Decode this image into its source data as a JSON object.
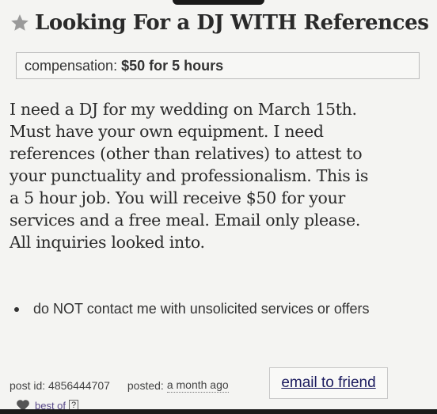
{
  "post": {
    "title": "Looking For a DJ WITH References",
    "compensation_label": "compensation:",
    "compensation_value": "$50 for 5 hours",
    "body_lines": [
      "I need a DJ for my wedding on March 15th.",
      "Must have your own equipment. I need",
      "references (other than relatives) to attest to",
      "your punctuality and professionalism. This is",
      "a 5 hour job. You will receive $50 for your",
      "services and a free meal. Email only please.",
      "All inquiries looked into."
    ],
    "notice": "do NOT contact me with unsolicited services or offers"
  },
  "footer": {
    "post_id": "post id: 4856444707",
    "posted_label": "posted:",
    "posted_value": "a month ago",
    "email_button": "email to friend",
    "best_of": "best of",
    "help": "?"
  },
  "icons": {
    "star": "star-icon",
    "heart": "heart-icon"
  },
  "colors": {
    "background": "#f4f4f2",
    "link": "#1a1a5e",
    "bestof": "#5a4a8a"
  }
}
